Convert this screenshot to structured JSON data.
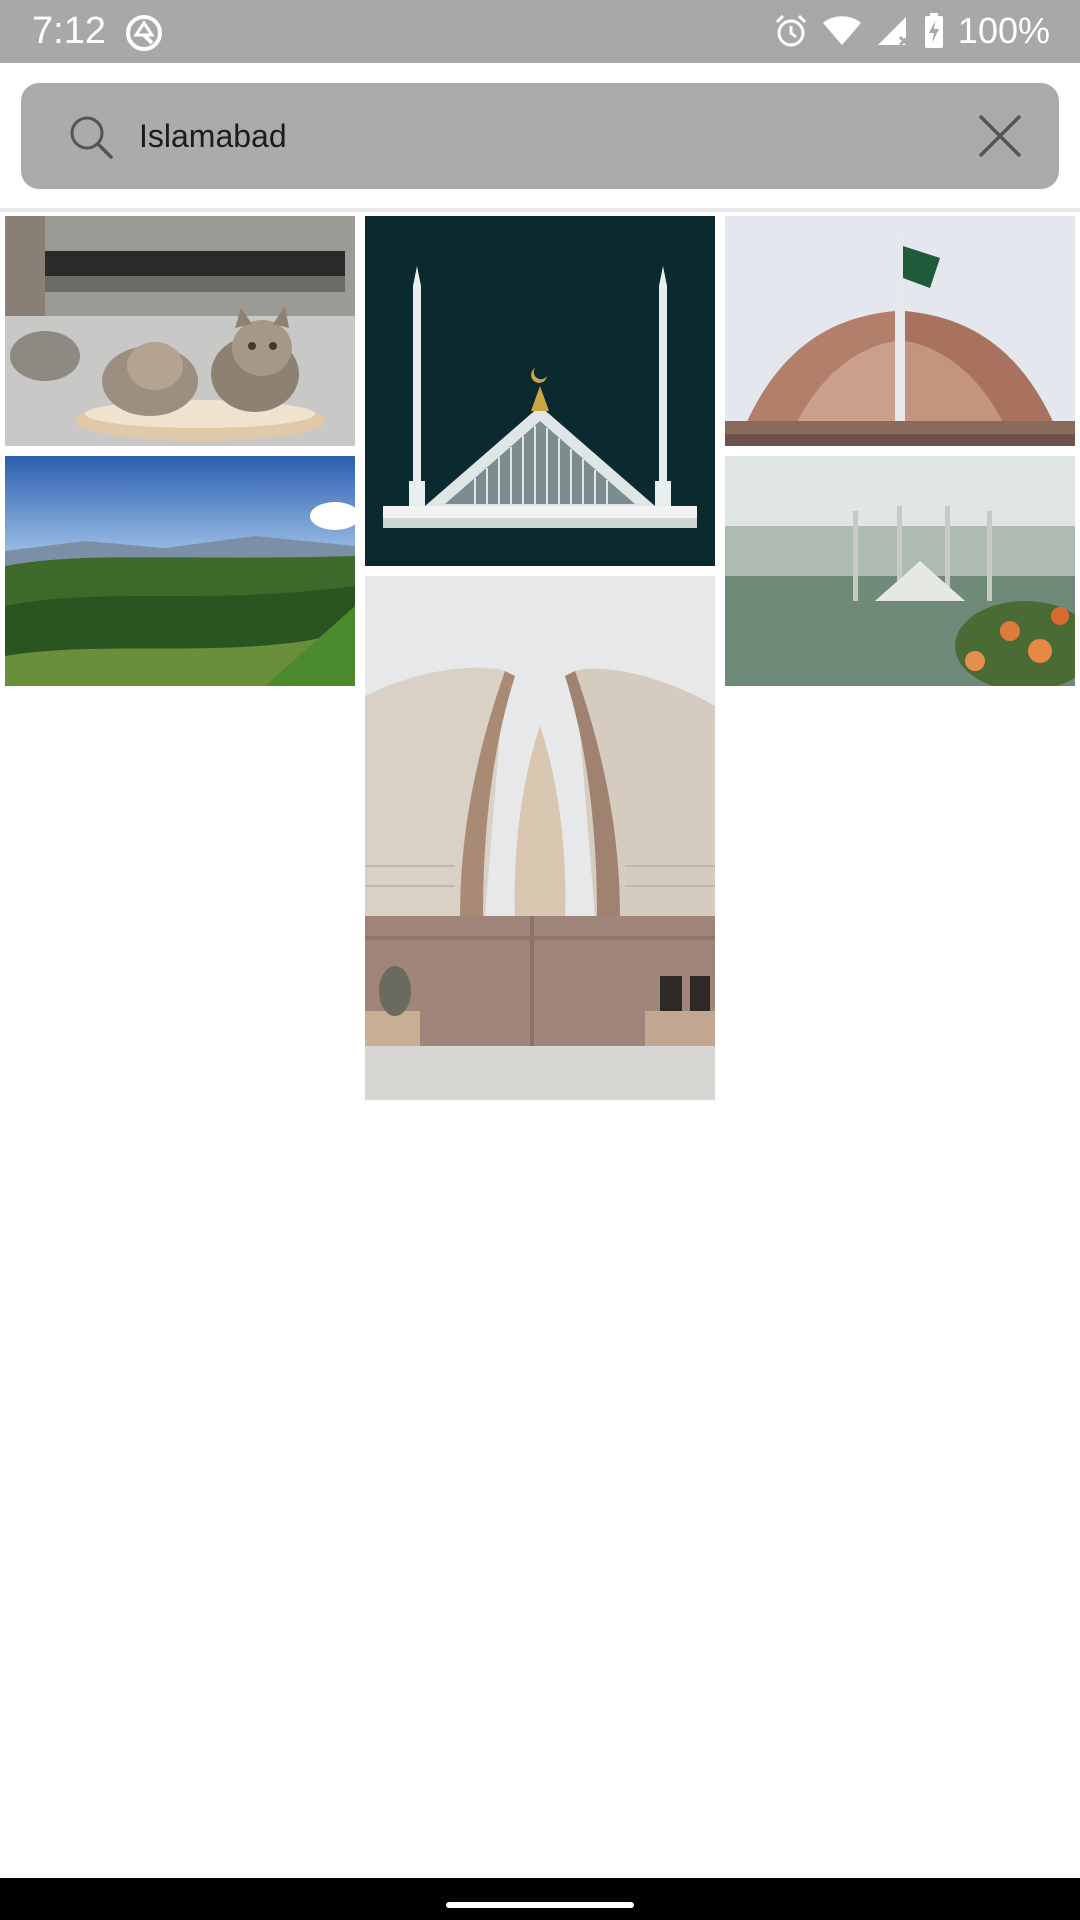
{
  "status_bar": {
    "time": "7:12",
    "battery": "100%",
    "icons": [
      "app-notification-icon",
      "alarm-icon",
      "wifi-icon",
      "cell-signal-icon",
      "battery-charging-icon"
    ]
  },
  "search": {
    "query": "Islamabad",
    "icons": [
      "search-icon",
      "close-icon"
    ]
  },
  "results": [
    {
      "name": "result-kittens"
    },
    {
      "name": "result-faisal-mosque-illustration"
    },
    {
      "name": "result-pakistan-monument-flag"
    },
    {
      "name": "result-green-hills"
    },
    {
      "name": "result-faisal-mosque-city-view"
    },
    {
      "name": "result-pakistan-monument-closeup"
    }
  ],
  "colors": {
    "status_bar": "#a8a8a8",
    "search_box": "#ababab",
    "illustration_bg": "#0a2a2f"
  }
}
